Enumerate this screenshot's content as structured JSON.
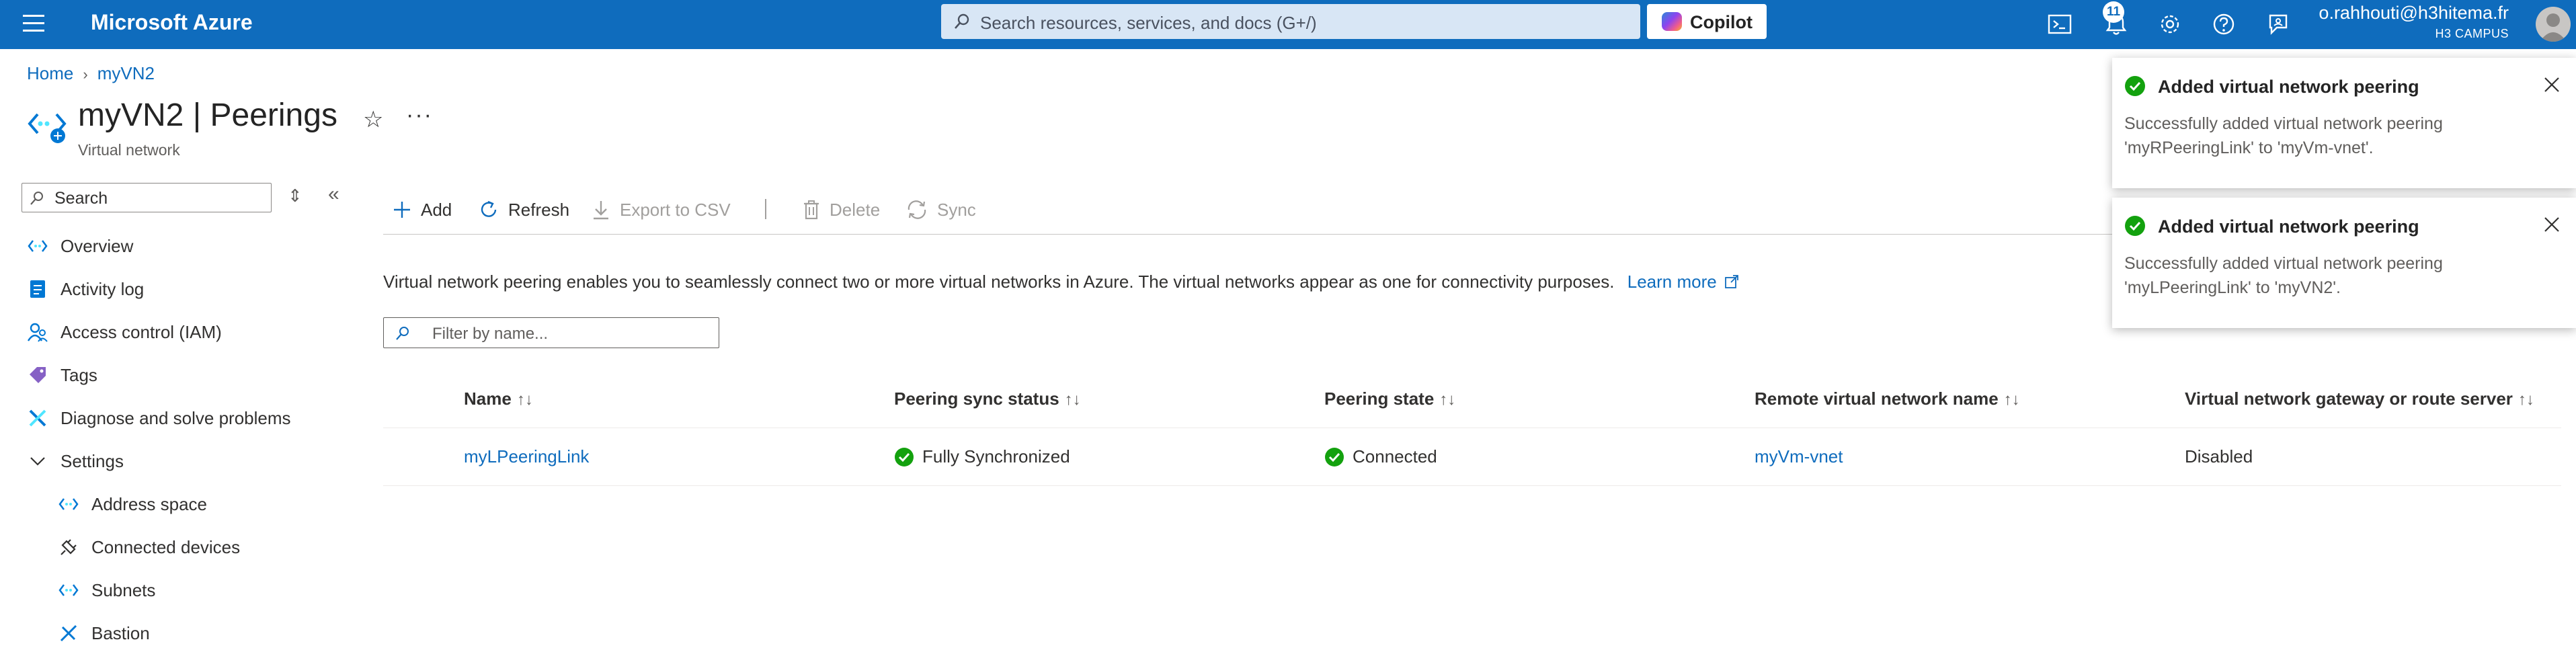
{
  "topbar": {
    "brand": "Microsoft Azure",
    "search_placeholder": "Search resources, services, and docs (G+/)",
    "copilot_label": "Copilot",
    "notification_count": "11",
    "user_name": "o.rahhouti@h3hitema.fr",
    "user_org": "H3 CAMPUS",
    "icons": [
      "cloud-shell-icon",
      "notifications-icon",
      "settings-icon",
      "help-icon",
      "feedback-icon"
    ]
  },
  "breadcrumb": {
    "home": "Home",
    "current": "myVN2"
  },
  "page": {
    "title": "myVN2 | Peerings",
    "subtitle": "Virtual network"
  },
  "nav": {
    "search_placeholder": "Search",
    "items": [
      {
        "label": "Overview",
        "icon": "vnet-icon"
      },
      {
        "label": "Activity log",
        "icon": "activity-log-icon"
      },
      {
        "label": "Access control (IAM)",
        "icon": "iam-icon"
      },
      {
        "label": "Tags",
        "icon": "tag-icon"
      },
      {
        "label": "Diagnose and solve problems",
        "icon": "diagnose-icon"
      },
      {
        "label": "Settings",
        "icon": "chevron-down-icon"
      },
      {
        "label": "Address space",
        "icon": "vnet-icon"
      },
      {
        "label": "Connected devices",
        "icon": "plug-icon"
      },
      {
        "label": "Subnets",
        "icon": "vnet-icon"
      },
      {
        "label": "Bastion",
        "icon": "bastion-icon"
      }
    ]
  },
  "toolbar": {
    "add": "Add",
    "refresh": "Refresh",
    "export": "Export to CSV",
    "delete": "Delete",
    "sync": "Sync"
  },
  "description": {
    "text": "Virtual network peering enables you to seamlessly connect two or more virtual networks in Azure. The virtual networks appear as one for connectivity purposes.",
    "learn_more": "Learn more"
  },
  "filter_placeholder": "Filter by name...",
  "table": {
    "columns": [
      "Name",
      "Peering sync status",
      "Peering state",
      "Remote virtual network name",
      "Virtual network gateway or route server"
    ],
    "rows": [
      {
        "name": "myLPeeringLink",
        "sync_status": "Fully Synchronized",
        "state": "Connected",
        "remote": "myVm-vnet",
        "gateway": "Disabled"
      }
    ]
  },
  "toasts": [
    {
      "title": "Added virtual network peering",
      "body": "Successfully added virtual network peering 'myRPeeringLink' to 'myVm-vnet'."
    },
    {
      "title": "Added virtual network peering",
      "body": "Successfully added virtual network peering 'myLPeeringLink' to 'myVN2'."
    }
  ],
  "colors": {
    "topbar": "#0f6cbd",
    "link": "#0f6cbd",
    "success": "#13a10e"
  }
}
